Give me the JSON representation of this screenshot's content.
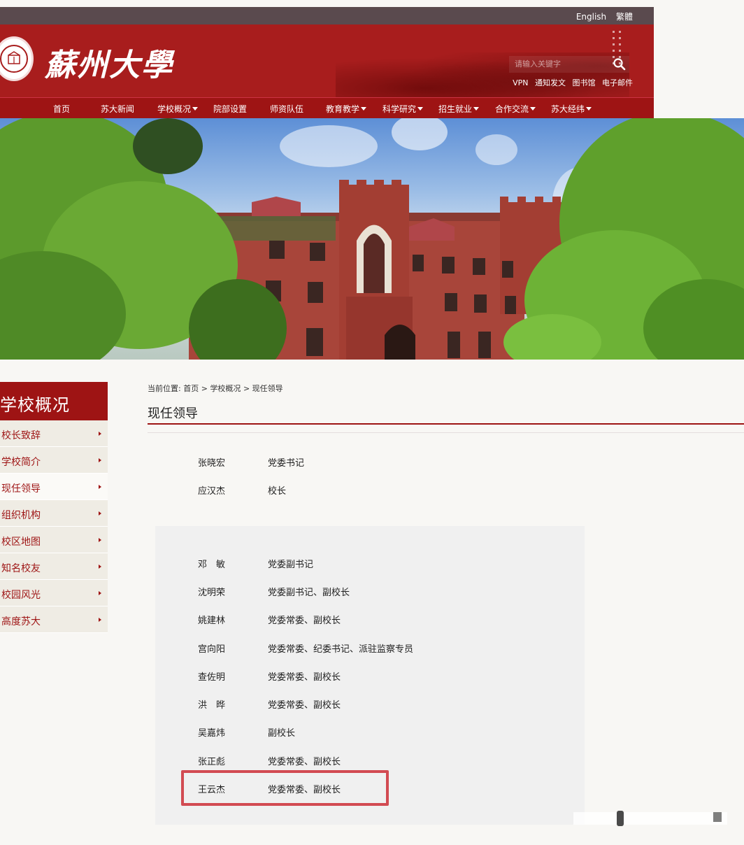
{
  "topbar": {
    "english": "English",
    "traditional": "繁體"
  },
  "header": {
    "logo_text": "蘇州大學",
    "search_placeholder": "请输入关键字",
    "quick_links": [
      "VPN",
      "通知发文",
      "图书馆",
      "电子邮件"
    ]
  },
  "nav": {
    "items": [
      {
        "label": "首页",
        "dropdown": false
      },
      {
        "label": "苏大新闻",
        "dropdown": false
      },
      {
        "label": "学校概况",
        "dropdown": true
      },
      {
        "label": "院部设置",
        "dropdown": false
      },
      {
        "label": "师资队伍",
        "dropdown": false
      },
      {
        "label": "教育教学",
        "dropdown": true
      },
      {
        "label": "科学研究",
        "dropdown": true
      },
      {
        "label": "招生就业",
        "dropdown": true
      },
      {
        "label": "合作交流",
        "dropdown": true
      },
      {
        "label": "苏大经纬",
        "dropdown": true
      }
    ]
  },
  "sidebar": {
    "title": "学校概况",
    "items": [
      {
        "label": "校长致辞"
      },
      {
        "label": "学校简介"
      },
      {
        "label": "现任领导",
        "active": true
      },
      {
        "label": "组织机构"
      },
      {
        "label": "校区地图"
      },
      {
        "label": "知名校友"
      },
      {
        "label": "校园风光"
      },
      {
        "label": "高度苏大"
      }
    ]
  },
  "breadcrumb": {
    "prefix": "当前位置:",
    "items": [
      "首页",
      "学校概况",
      "现任领导"
    ],
    "separator": ">"
  },
  "page_title": "现任领导",
  "leaders_top": [
    {
      "name": "张晓宏",
      "role": "党委书记"
    },
    {
      "name": "应汉杰",
      "role": "校长"
    }
  ],
  "leaders_panel": [
    {
      "name": "邓　敏",
      "role": "党委副书记"
    },
    {
      "name": "沈明荣",
      "role": "党委副书记、副校长"
    },
    {
      "name": "姚建林",
      "role": "党委常委、副校长"
    },
    {
      "name": "宫向阳",
      "role": "党委常委、纪委书记、派驻监察专员"
    },
    {
      "name": "查佐明",
      "role": "党委常委、副校长"
    },
    {
      "name": "洪　晔",
      "role": "党委常委、副校长"
    },
    {
      "name": "吴嘉炜",
      "role": "副校长"
    },
    {
      "name": "张正彪",
      "role": "党委常委、副校长"
    },
    {
      "name": "王云杰",
      "role": "党委常委、副校长",
      "highlighted": true
    }
  ],
  "colors": {
    "brand_red": "#9e1414",
    "highlight": "#d24b52",
    "topbar": "#5a4a4e"
  }
}
